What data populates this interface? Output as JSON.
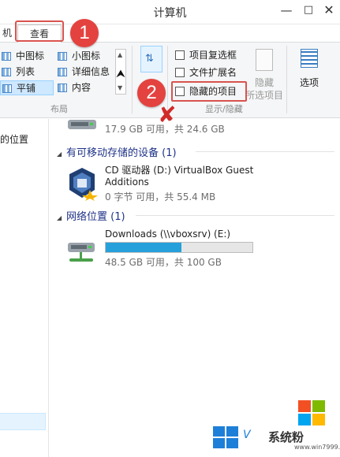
{
  "window": {
    "title": "计算机",
    "min_glyph": "—",
    "max_glyph": "□",
    "close_glyph": "✕"
  },
  "tabs": {
    "machine": "机",
    "view": "查看",
    "pin_glyph": "⇦",
    "help_glyph": "?"
  },
  "ribbon": {
    "layout": {
      "items": {
        "medium": "中图标",
        "list": "列表",
        "tiles": "平铺",
        "small": "小图标",
        "details": "详细信息",
        "content": "内容"
      },
      "selected": "tiles",
      "group_label": "布局"
    },
    "show_hide": {
      "item_checkboxes": "项目复选框",
      "file_extensions": "文件扩展名",
      "hidden_items": "隐藏的项目",
      "hide_selected_line1": "隐藏",
      "hide_selected_line2": "所选项目",
      "group_label": "显示/隐藏"
    },
    "options": "选项"
  },
  "callouts": {
    "one": "1",
    "two": "2"
  },
  "nav": {
    "recent_places": "的位置"
  },
  "content": {
    "drive_top_size": "17.9 GB 可用，共 24.6 GB",
    "removable_header": "有可移动存储的设备 (1)",
    "cd_name": "CD 驱动器 (D:) VirtualBox Guest Additions",
    "cd_size": "0 字节 可用，共 55.4 MB",
    "network_header": "网络位置 (1)",
    "net_name": "Downloads (\\\\vboxsrv) (E:)",
    "net_size": "48.5 GB 可用，共 100 GB",
    "net_used_fraction": 0.515
  },
  "watermark": {
    "brand": "系统粉",
    "url": "www.win7999.com",
    "v": "V"
  },
  "colors": {
    "accent_blue": "#26a0da",
    "highlight_red": "#e4423f",
    "ms_red": "#f25022",
    "ms_green": "#7fba00",
    "ms_blue": "#00a4ef",
    "ms_yellow": "#ffb900"
  }
}
